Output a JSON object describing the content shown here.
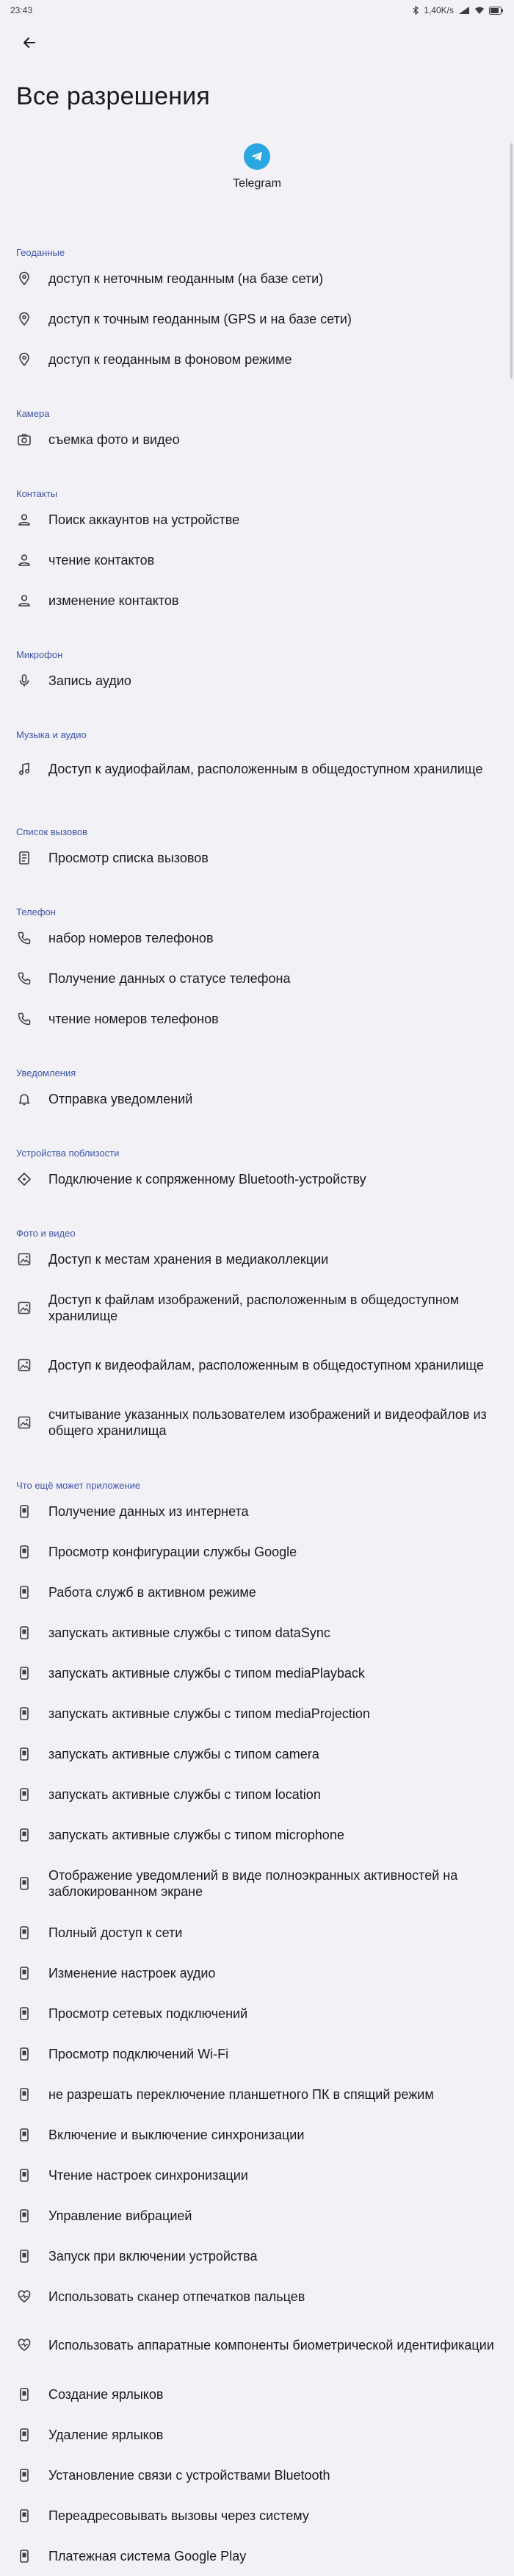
{
  "status": {
    "time": "23:43",
    "speed": "1,40K/s"
  },
  "page_title": "Все разрешения",
  "app": {
    "name": "Telegram"
  },
  "sections": [
    {
      "header": "Геоданные",
      "items": [
        {
          "label": "доступ к неточным геоданным (на базе сети)",
          "icon": "location"
        },
        {
          "label": "доступ к точным геоданным (GPS и на базе сети)",
          "icon": "location"
        },
        {
          "label": "доступ к геоданным в фоновом режиме",
          "icon": "location"
        }
      ]
    },
    {
      "header": "Камера",
      "items": [
        {
          "label": "съемка фото и видео",
          "icon": "camera"
        }
      ]
    },
    {
      "header": "Контакты",
      "items": [
        {
          "label": "Поиск аккаунтов на устройстве",
          "icon": "person"
        },
        {
          "label": "чтение контактов",
          "icon": "person"
        },
        {
          "label": "изменение контактов",
          "icon": "person"
        }
      ]
    },
    {
      "header": "Микрофон",
      "items": [
        {
          "label": "Запись аудио",
          "icon": "mic"
        }
      ]
    },
    {
      "header": "Музыка и аудио",
      "items": [
        {
          "label": "Доступ к аудиофайлам, расположенным в общедоступном хранилище",
          "icon": "music",
          "multi": true
        }
      ]
    },
    {
      "header": "Список вызовов",
      "items": [
        {
          "label": "Просмотр списка вызовов",
          "icon": "calllog"
        }
      ]
    },
    {
      "header": "Телефон",
      "items": [
        {
          "label": "набор номеров телефонов",
          "icon": "phone"
        },
        {
          "label": "Получение данных о статусе телефона",
          "icon": "phone"
        },
        {
          "label": "чтение номеров телефонов",
          "icon": "phone"
        }
      ]
    },
    {
      "header": "Уведомления",
      "items": [
        {
          "label": "Отправка уведомлений",
          "icon": "bell"
        }
      ]
    },
    {
      "header": "Устройства поблизости",
      "items": [
        {
          "label": "Подключение к сопряженному Bluetooth-устройству",
          "icon": "nearby"
        }
      ]
    },
    {
      "header": "Фото и видео",
      "items": [
        {
          "label": "Доступ к местам хранения в медиаколлекции",
          "icon": "image"
        },
        {
          "label": "Доступ к файлам изображений, расположенным в общедоступном хранилище",
          "icon": "image",
          "multi": true
        },
        {
          "label": "Доступ к видеофайлам, расположенным в общедоступном хранилище",
          "icon": "image",
          "multi": true
        },
        {
          "label": "считывание указанных пользователем изображений и видеофайлов из общего хранилища",
          "icon": "image",
          "multi": true
        }
      ]
    },
    {
      "header": "Что ещё может приложение",
      "items": [
        {
          "label": "Получение данных из интернета",
          "icon": "device"
        },
        {
          "label": "Просмотр конфигурации службы Google",
          "icon": "device"
        },
        {
          "label": "Работа служб в активном режиме",
          "icon": "device"
        },
        {
          "label": "запускать активные службы с типом dataSync",
          "icon": "device"
        },
        {
          "label": "запускать активные службы с типом mediaPlayback",
          "icon": "device"
        },
        {
          "label": "запускать активные службы с типом mediaProjection",
          "icon": "device"
        },
        {
          "label": "запускать активные службы с типом camera",
          "icon": "device"
        },
        {
          "label": "запускать активные службы с типом location",
          "icon": "device"
        },
        {
          "label": "запускать активные службы с типом microphone",
          "icon": "device"
        },
        {
          "label": "Отображение уведомлений в виде полноэкранных активностей на заблокированном экране",
          "icon": "device",
          "multi": true
        },
        {
          "label": "Полный доступ к сети",
          "icon": "device"
        },
        {
          "label": "Изменение настроек аудио",
          "icon": "device"
        },
        {
          "label": "Просмотр сетевых подключений",
          "icon": "device"
        },
        {
          "label": "Просмотр подключений Wi-Fi",
          "icon": "device"
        },
        {
          "label": "не разрешать переключение планшетного ПК в спящий режим",
          "icon": "device"
        },
        {
          "label": "Включение и выключение синхронизации",
          "icon": "device"
        },
        {
          "label": "Чтение настроек синхронизации",
          "icon": "device"
        },
        {
          "label": "Управление вибрацией",
          "icon": "device"
        },
        {
          "label": "Запуск при включении устройства",
          "icon": "device"
        },
        {
          "label": "Использовать сканер отпечатков пальцев",
          "icon": "biometric"
        },
        {
          "label": "Использовать аппаратные компоненты биометрической идентификации",
          "icon": "biometric",
          "multi": true
        },
        {
          "label": "Создание ярлыков",
          "icon": "device"
        },
        {
          "label": "Удаление ярлыков",
          "icon": "device"
        },
        {
          "label": "Установление связи с устройствами Bluetooth",
          "icon": "device"
        },
        {
          "label": "Переадресовывать вызовы через систему",
          "icon": "device"
        },
        {
          "label": "Платежная система Google Play",
          "icon": "device"
        }
      ]
    }
  ]
}
